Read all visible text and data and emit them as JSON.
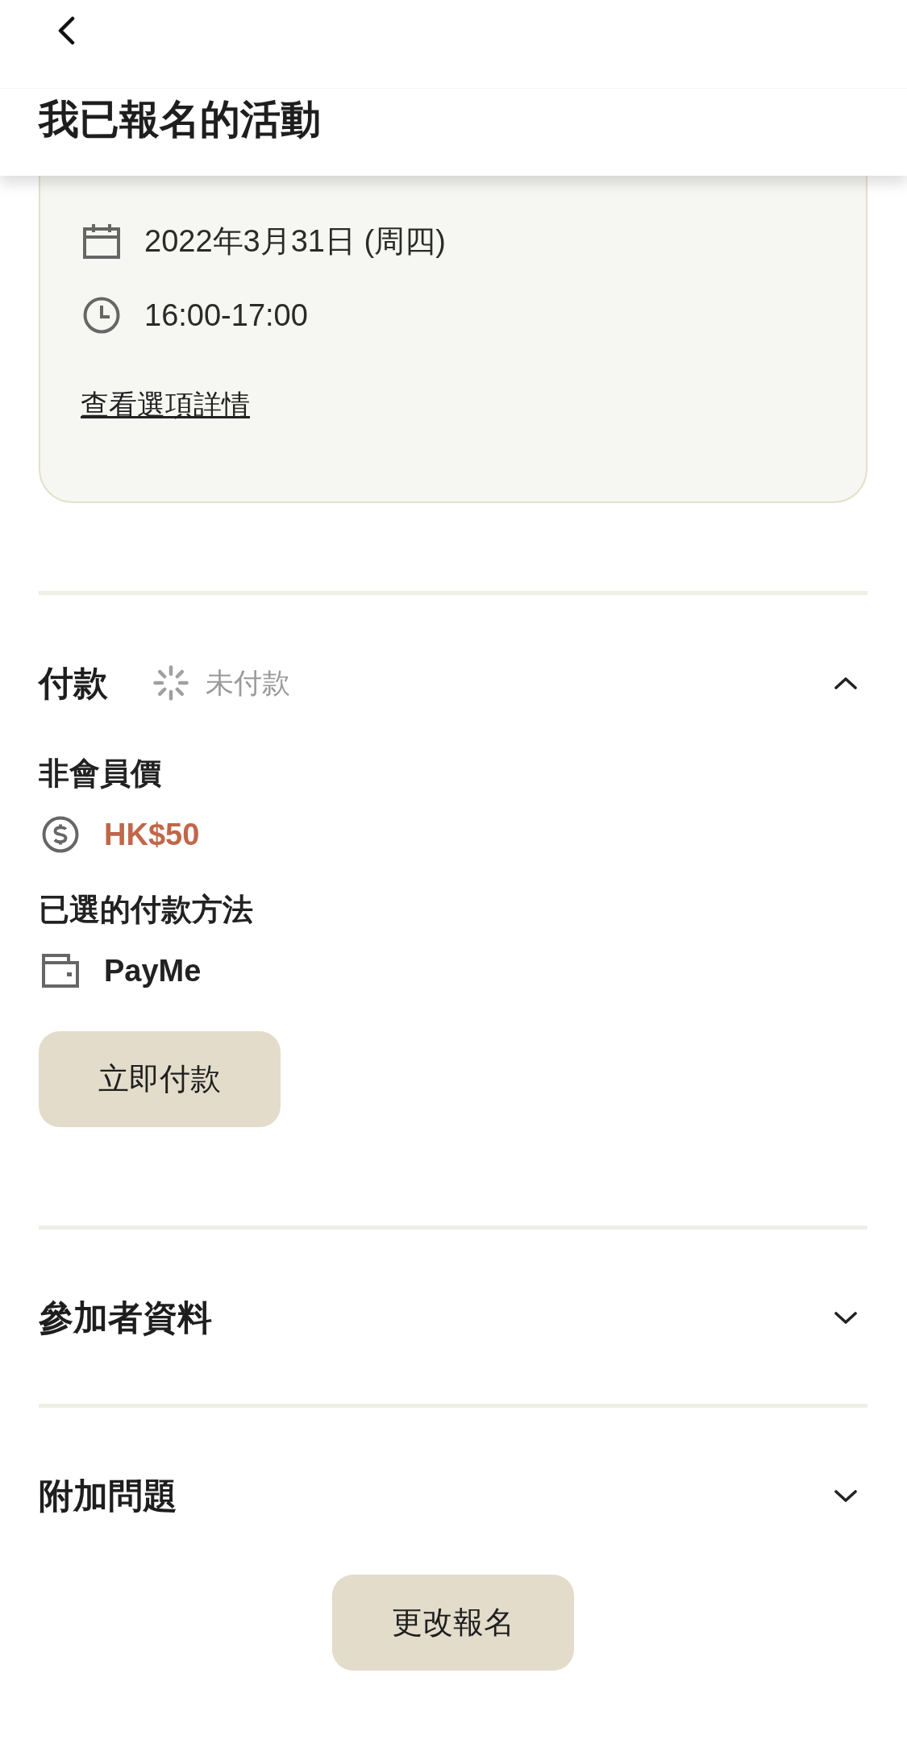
{
  "header": {
    "title": "我已報名的活動"
  },
  "event_card": {
    "details": [
      {
        "kind": "date",
        "text": "2022年3月31日 (周四)"
      },
      {
        "kind": "time",
        "text": "16:00-17:00"
      }
    ],
    "link": "查看選項詳情"
  },
  "sections": [
    {
      "title": "付款",
      "expanded": true,
      "status": {
        "kind": "pending",
        "text": "未付款"
      },
      "body": [
        {
          "kind": "label",
          "text": "非會員價"
        },
        {
          "kind": "price",
          "text": "HK$50"
        },
        {
          "kind": "label",
          "text": "已選的付款方法"
        },
        {
          "kind": "wallet",
          "text": "PayMe"
        },
        {
          "kind": "button",
          "text": "立即付款"
        }
      ]
    },
    {
      "title": "參加者資料",
      "expanded": false
    },
    {
      "title": "附加問題",
      "expanded": false
    }
  ],
  "footer_button": {
    "label": "更改報名"
  }
}
